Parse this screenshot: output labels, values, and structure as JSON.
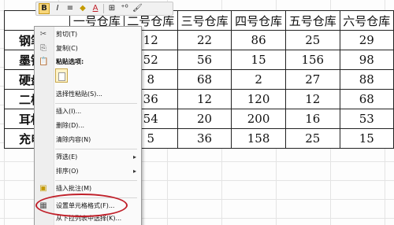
{
  "mini_toolbar": {
    "bold_label": "B",
    "italic_label": "I",
    "align_icon": "≡",
    "fill_icon": "◆",
    "font_color_label": "A",
    "border_icon": "⊞",
    "decimal_label": "⁺⁰",
    "brush_icon": "🖌"
  },
  "table": {
    "header": [
      "",
      "一号仓库",
      "二号仓库",
      "三号仓库",
      "四号仓库",
      "五号仓库",
      "六号仓库"
    ],
    "rows": [
      {
        "name": "钢笔",
        "values": [
          "",
          "12",
          "22",
          "86",
          "25",
          "29"
        ]
      },
      {
        "name": "墨镜",
        "values": [
          "",
          "52",
          "56",
          "15",
          "156",
          "98"
        ]
      },
      {
        "name": "硬盘",
        "values": [
          "",
          "8",
          "68",
          "2",
          "27",
          "88"
        ]
      },
      {
        "name": "二极管",
        "values": [
          "",
          "36",
          "12",
          "120",
          "12",
          "68"
        ]
      },
      {
        "name": "耳机",
        "values": [
          "",
          "54",
          "20",
          "200",
          "16",
          "53"
        ]
      },
      {
        "name": "充电器",
        "values": [
          "",
          "5",
          "36",
          "158",
          "25",
          "15"
        ]
      }
    ]
  },
  "context_menu": {
    "items": [
      {
        "label": "剪切(T)",
        "icon": "✂"
      },
      {
        "label": "复制(C)",
        "icon": "⎘"
      },
      {
        "label": "粘贴选项:",
        "icon": "📋"
      },
      {
        "label": "选择性粘贴(S)...",
        "icon": ""
      },
      {
        "label": "插入(I)...",
        "icon": ""
      },
      {
        "label": "删除(D)...",
        "icon": ""
      },
      {
        "label": "清除内容(N)",
        "icon": ""
      },
      {
        "label": "筛选(E)",
        "icon": "",
        "submenu": "▸"
      },
      {
        "label": "排序(O)",
        "icon": "",
        "submenu": "▸"
      },
      {
        "label": "插入批注(M)",
        "icon": "▣"
      },
      {
        "label": "设置单元格格式(F)...",
        "icon": "▦"
      },
      {
        "label": "从下拉列表中选择(K)...",
        "icon": ""
      }
    ]
  }
}
